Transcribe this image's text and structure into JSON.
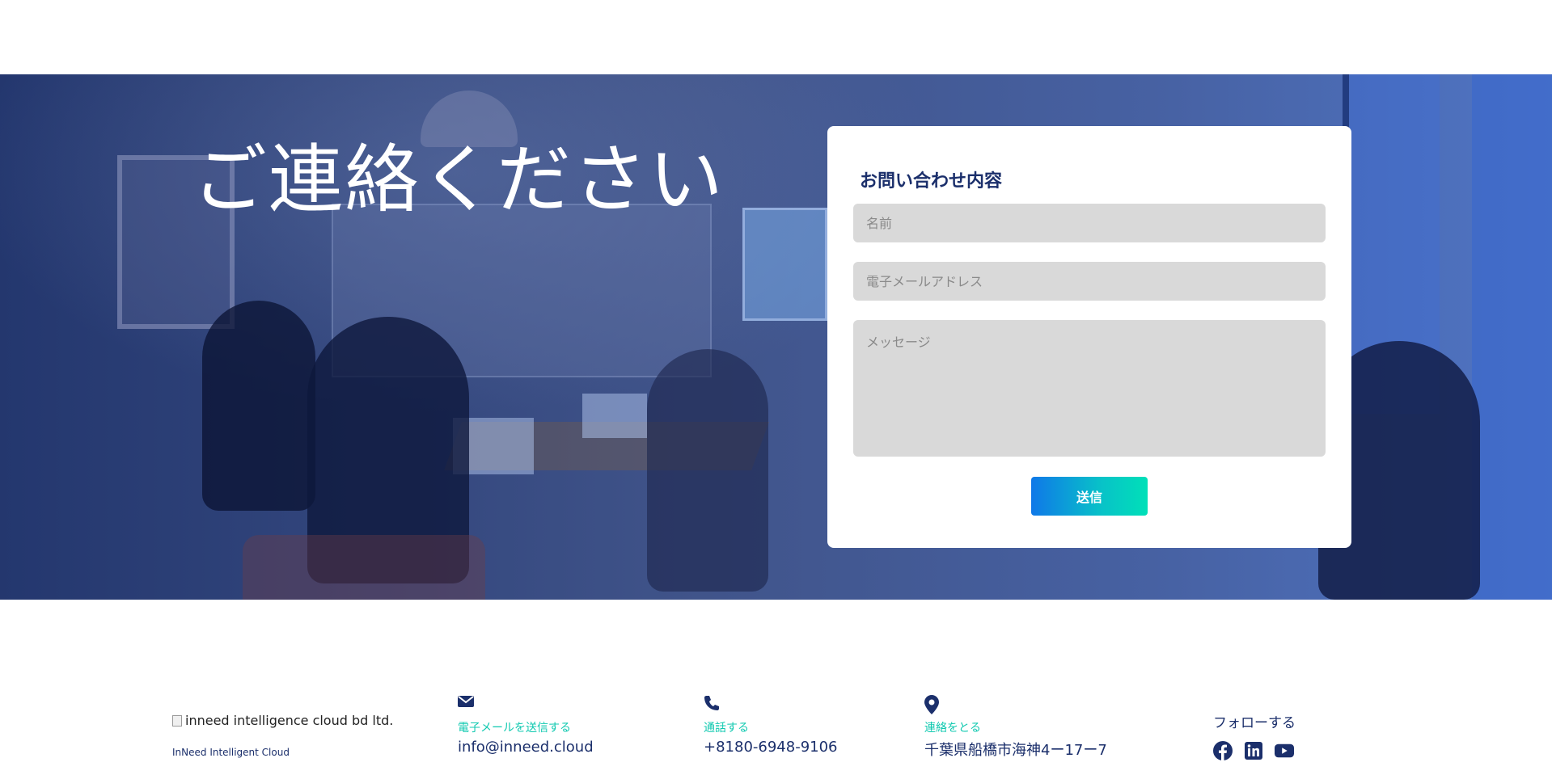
{
  "hero": {
    "title": "ご連絡ください"
  },
  "contact_form": {
    "title": "お問い合わせ内容",
    "name_placeholder": "名前",
    "name_value": "",
    "email_placeholder": "電子メールアドレス",
    "email_value": "",
    "message_placeholder": "メッセージ",
    "message_value": "",
    "submit_label": "送信"
  },
  "footer": {
    "logo_alt": "inneed intelligence cloud bd ltd.",
    "company_name": "InNeed Intelligent Cloud",
    "email": {
      "icon": "envelope-icon",
      "label": "電子メールを送信する",
      "value": "info@inneed.cloud"
    },
    "phone": {
      "icon": "phone-icon",
      "label": "通話する",
      "value": "+8180-6948-9106"
    },
    "address": {
      "icon": "map-pin-icon",
      "label": "連絡をとる",
      "value": "千葉県船橋市海神4ー17ー7"
    },
    "follow": {
      "label": "フォローする",
      "socials": [
        "facebook-icon",
        "linkedin-icon",
        "youtube-icon"
      ]
    }
  },
  "colors": {
    "navy": "#1b2f6b",
    "teal_label": "#10c9b0",
    "button_gradient_start": "#0f78e8",
    "button_gradient_end": "#00e0b8",
    "input_bg": "#d9d9d9"
  }
}
